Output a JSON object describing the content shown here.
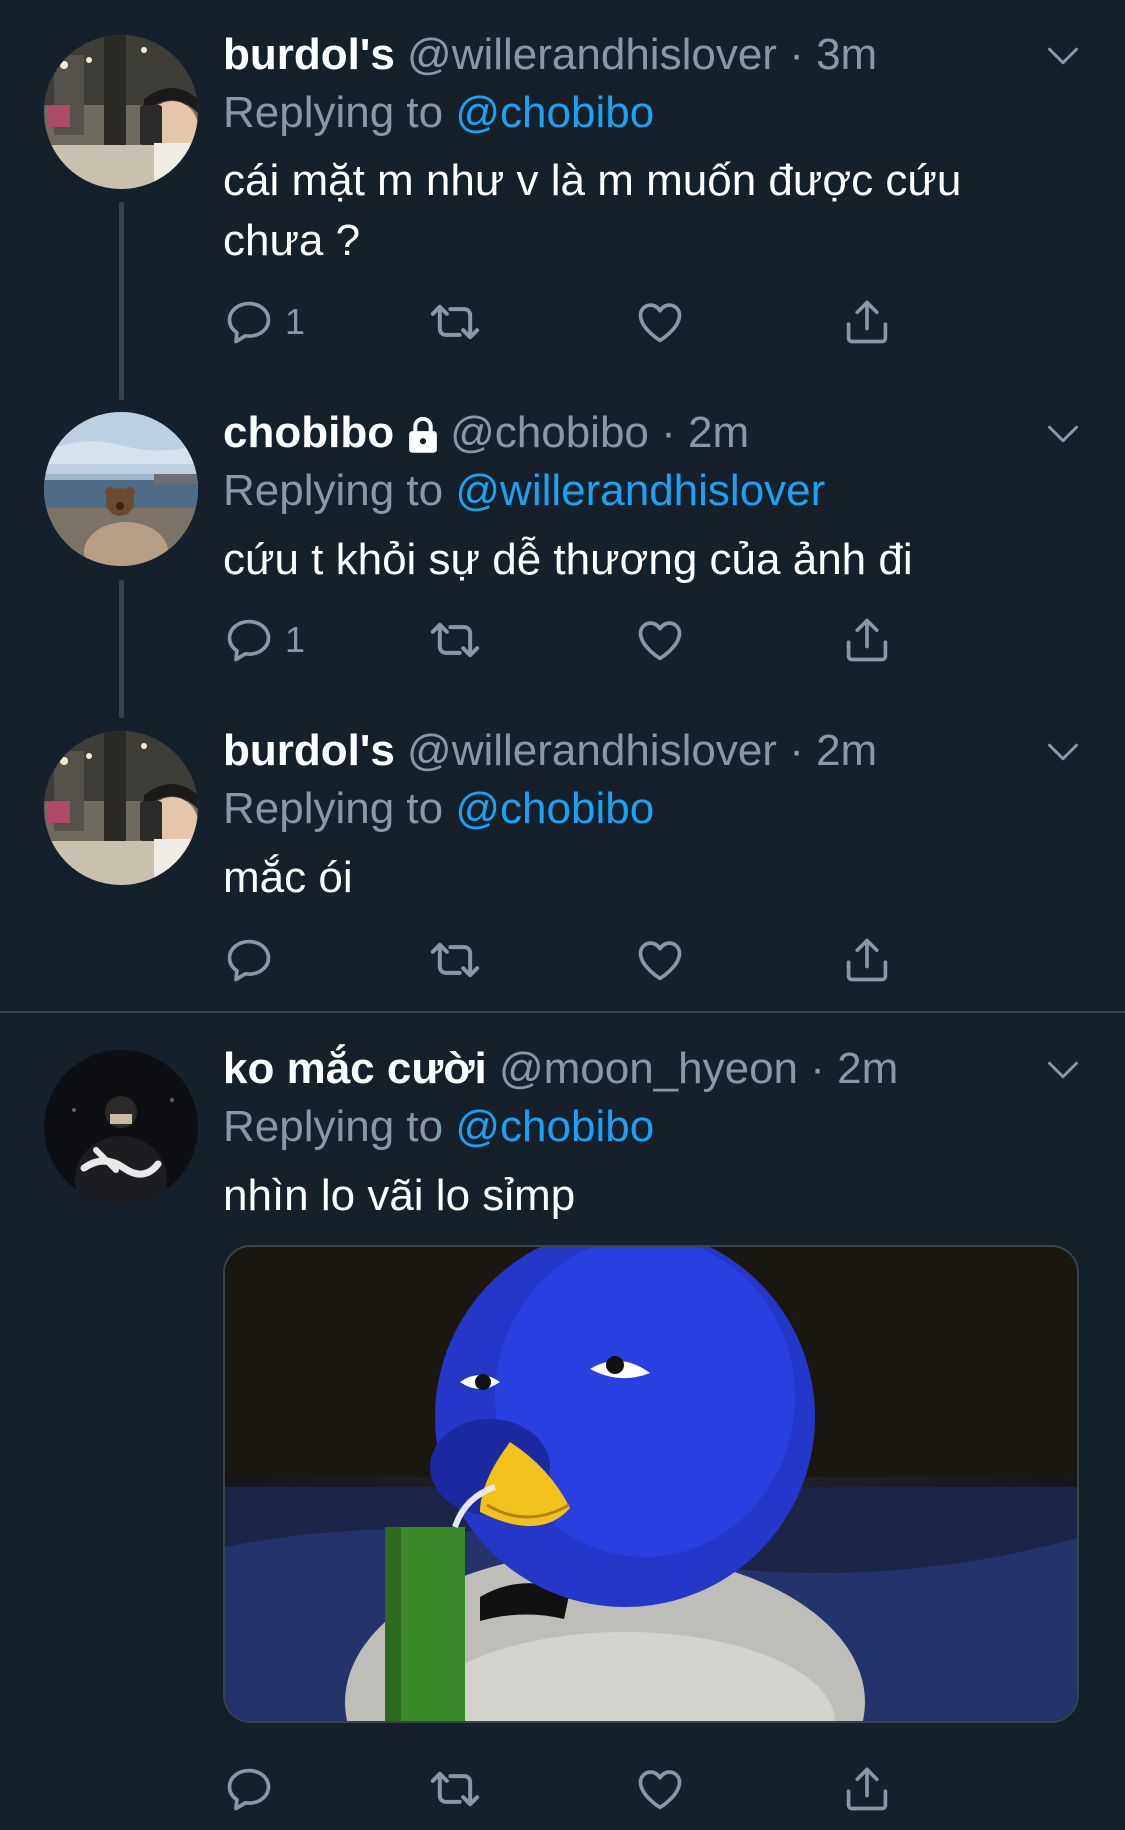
{
  "colors": {
    "background": "#15202b",
    "muted": "#8899a6",
    "link": "#1da1f2",
    "divider": "#38444d"
  },
  "tweets": [
    {
      "name": "burdol's",
      "handle": "@willerandhislover",
      "dot": "·",
      "time": "3m",
      "replying_prefix": "Replying to",
      "replying_to": "@chobibo",
      "text_lines": [
        "cái mặt m như v là m muốn được cứu",
        "chưa ?"
      ],
      "reply_count": "1",
      "protected": false,
      "avatar": "gym-mirror-selfie"
    },
    {
      "name": "chobibo",
      "handle": "@chobibo",
      "dot": "·",
      "time": "2m",
      "replying_prefix": "Replying to",
      "replying_to": "@willerandhislover",
      "text_lines": [
        "cứu t khỏi sự dễ thương của ảnh đi"
      ],
      "reply_count": "1",
      "protected": true,
      "avatar": "beach-teddy-bear"
    },
    {
      "name": "burdol's",
      "handle": "@willerandhislover",
      "dot": "·",
      "time": "2m",
      "replying_prefix": "Replying to",
      "replying_to": "@chobibo",
      "text_lines": [
        "mắc ói"
      ],
      "reply_count": "",
      "protected": false,
      "avatar": "gym-mirror-selfie"
    },
    {
      "name": "ko mắc cười",
      "handle": "@moon_hyeon",
      "dot": "·",
      "time": "2m",
      "replying_prefix": "Replying to",
      "replying_to": "@chobibo",
      "text_lines": [
        "nhìn lo vãi lo sỉmp"
      ],
      "reply_count": "",
      "protected": false,
      "avatar": "dark-night-figure",
      "media": "blue-penguin-meme"
    }
  ],
  "icons": {
    "reply": "reply-icon",
    "retweet": "retweet-icon",
    "like": "heart-icon",
    "share": "share-icon",
    "more": "chevron-down-icon",
    "lock": "lock-icon"
  }
}
